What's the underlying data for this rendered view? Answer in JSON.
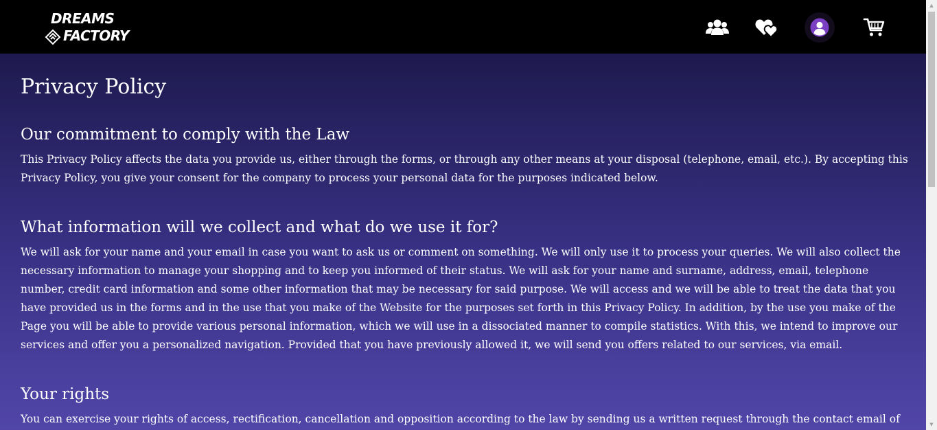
{
  "header": {
    "logo": {
      "line1": "DREAMS",
      "line2": "FACTORY"
    },
    "nav": [
      {
        "icon": "users-icon"
      },
      {
        "icon": "wishlist-hearts-icon"
      },
      {
        "icon": "account-avatar-icon"
      },
      {
        "icon": "cart-icon"
      }
    ]
  },
  "page": {
    "title": "Privacy Policy",
    "sections": [
      {
        "heading": "Our commitment to comply with the Law",
        "body": "This Privacy Policy affects the data you provide us, either through the forms, or through any other means at your disposal (telephone, email, etc.). By accepting this Privacy Policy, you give your consent for the company to process your personal data for the purposes indicated below."
      },
      {
        "heading": "What information will we collect and what do we use it for?",
        "body": "We will ask for your name and your email in case you want to ask us or comment on something. We will only use it to process your queries. We will also collect the necessary information to manage your shopping and to keep you informed of their status. We will ask for your name and surname, address, email, telephone number, credit card information and some other information that may be necessary for said purpose. We will access and we will be able to treat the data that you have provided us in the forms and in the use that you make of the Website for the purposes set forth in this Privacy Policy. In addition, by the use you make of the Page you will be able to provide various personal information, which we will use in a dissociated manner to compile statistics. With this, we intend to improve our services and offer you a personalized navigation. Provided that you have previously allowed it, we will send you offers related to our services, via email."
      },
      {
        "heading": "Your rights",
        "body": "You can exercise your rights of access, rectification, cancellation and opposition according to the law by sending us a written request through the contact email of the page."
      }
    ]
  },
  "colors": {
    "header_bg": "#000000",
    "content_top": "#1e1a4e",
    "content_bottom": "#5146a8",
    "text": "#ffffff",
    "avatar": "#7b3fc4"
  }
}
